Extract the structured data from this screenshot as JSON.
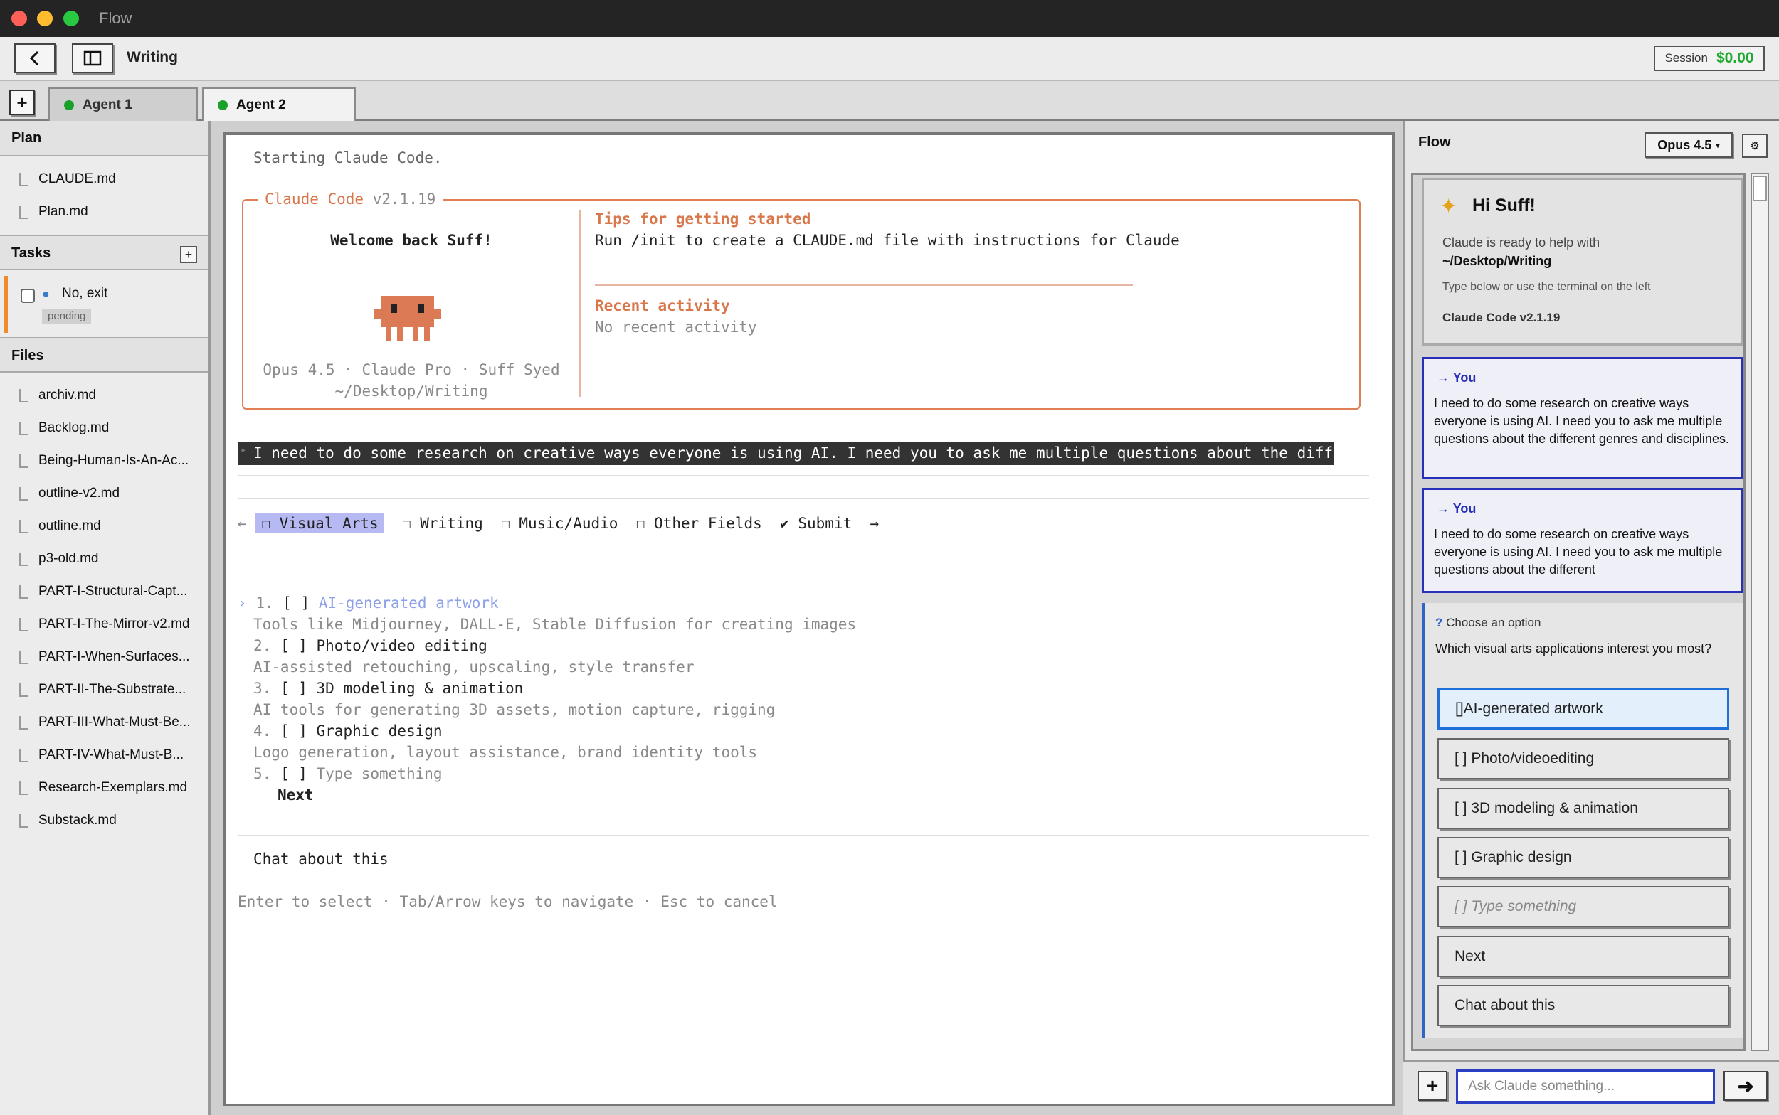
{
  "window": {
    "title": "Flow"
  },
  "toolbar": {
    "title": "Writing",
    "session_label": "Session",
    "session_cost": "$0.00"
  },
  "tabs": {
    "add": "+",
    "items": [
      {
        "label": "Agent 1",
        "status": "running"
      },
      {
        "label": "Agent 2",
        "status": "running"
      }
    ]
  },
  "sidebar": {
    "plan": {
      "title": "Plan",
      "items": [
        "CLAUDE.md",
        "Plan.md"
      ]
    },
    "tasks": {
      "title": "Tasks",
      "add": "+",
      "items": [
        {
          "label": "No, exit",
          "status": "pending"
        }
      ]
    },
    "files": {
      "title": "Files",
      "items": [
        "archiv.md",
        "Backlog.md",
        "Being-Human-Is-An-Ac...",
        "outline-v2.md",
        "outline.md",
        "p3-old.md",
        "PART-I-Structural-Capt...",
        "PART-I-The-Mirror-v2.md",
        "PART-I-When-Surfaces...",
        "PART-II-The-Substrate...",
        "PART-III-What-Must-Be...",
        "PART-IV-What-Must-B...",
        "Research-Exemplars.md",
        "Substack.md"
      ]
    }
  },
  "terminal": {
    "start": "Starting Claude Code.",
    "box_title": "Claude Code",
    "box_version": "v2.1.19",
    "welcome": "Welcome back Suff!",
    "account": "Opus 4.5 · Claude Pro · Suff Syed",
    "path": "~/Desktop/Writing",
    "tips_title": "Tips for getting started",
    "tips_text": "Run /init to create a CLAUDE.md file with instructions for Claude",
    "recent_title": "Recent activity",
    "recent_text": "No recent activity",
    "prompt": "I need to do some research on creative ways everyone is using AI. I need you to ask me multiple questions about the different",
    "qtabs": [
      "☐ Visual Arts",
      "☐ Writing",
      "☐ Music/Audio",
      "☐ Other Fields",
      "✔ Submit"
    ],
    "options": [
      {
        "num": "1.",
        "label": "AI-generated artwork",
        "desc": "Tools like Midjourney, DALL-E, Stable Diffusion for creating images"
      },
      {
        "num": "2.",
        "label": "Photo/video editing",
        "desc": "AI-assisted retouching, upscaling, style transfer"
      },
      {
        "num": "3.",
        "label": "3D modeling & animation",
        "desc": "AI tools for generating 3D assets, motion capture, rigging"
      },
      {
        "num": "4.",
        "label": "Graphic design",
        "desc": "Logo generation, layout assistance, brand identity tools"
      },
      {
        "num": "5.",
        "label": "Type something",
        "desc": ""
      }
    ],
    "next": "Next",
    "chat": "Chat about this",
    "hint": "Enter to select · Tab/Arrow keys to navigate · Esc to cancel"
  },
  "flow": {
    "title": "Flow",
    "model": "Opus 4.5",
    "greeting": "Hi Suff!",
    "ready": "Claude is ready to help with",
    "path": "~/Desktop/Writing",
    "hint": "Type below or use the terminal on the left",
    "version": "Claude Code v2.1.19",
    "messages": [
      {
        "author": "You",
        "text": "I need to do some research on creative ways everyone is using AI. I need you to ask me multiple questions about the different genres and disciplines."
      },
      {
        "author": "You",
        "text": "I need to do some research on creative ways everyone is using AI. I need you to ask me multiple questions about the different"
      }
    ],
    "choose": "Choose an option",
    "question": "Which visual arts applications interest you most?",
    "options": [
      "[]AI-generated artwork",
      "[ ] Photo/videoediting",
      "[ ] 3D modeling & animation",
      "[ ] Graphic design",
      "[ ] Type something",
      "Next",
      "Chat about this"
    ],
    "input_placeholder": "Ask Claude something..."
  },
  "colors": {
    "accent_orange": "#d9764a",
    "selection_blue": "#1f6fd8",
    "user_border": "#2930b8",
    "session_green": "#1faa2f"
  }
}
